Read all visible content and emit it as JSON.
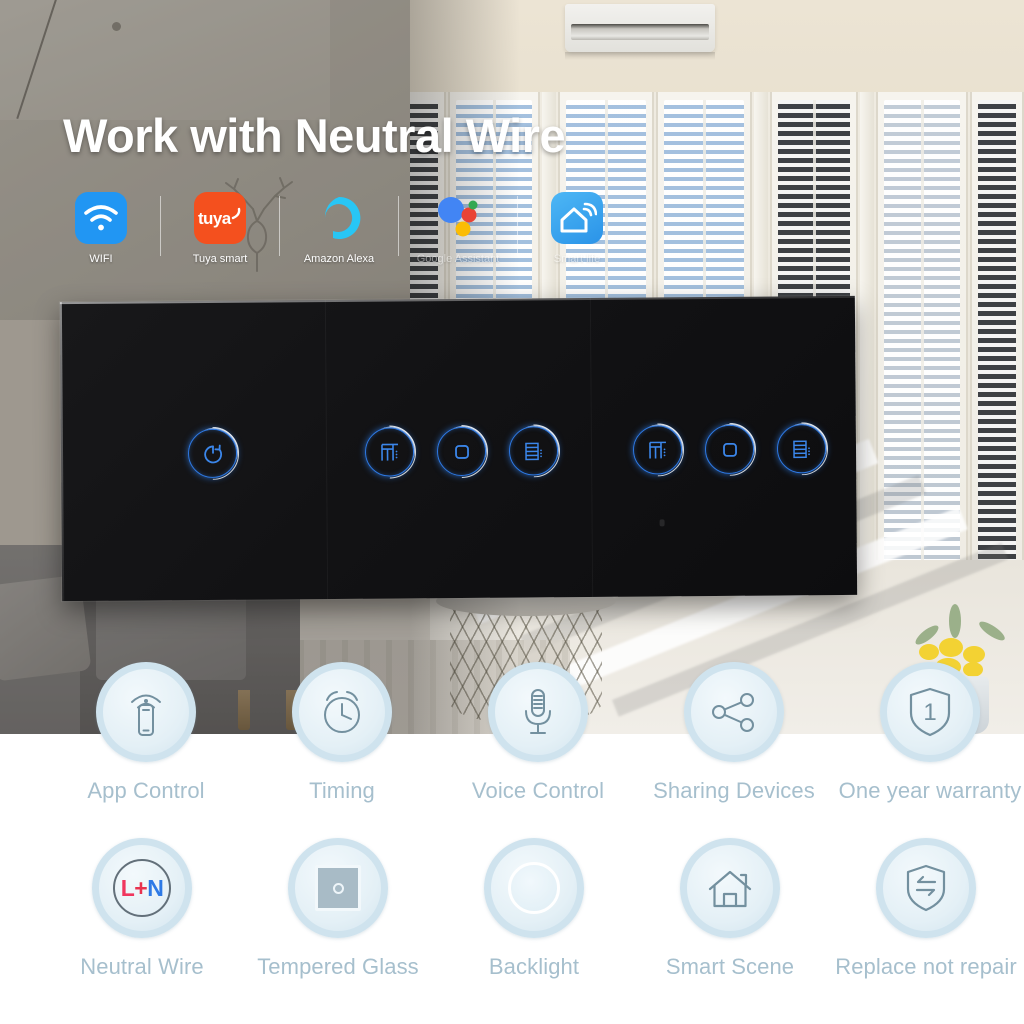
{
  "headline": "Work with Neutral Wire",
  "colors": {
    "wifi_blue": "#2196f3",
    "tuya_orange": "#f4501e",
    "alexa_cyan": "#28c6f5",
    "smartlife_blue": "#3aa8f0",
    "touch_key_blue": "#2e7ae6",
    "feature_label": "#a6bfcd",
    "feature_circle_border": "#cfe3ee",
    "panel_black": "#121214",
    "neutral_l_red": "#f0365e",
    "neutral_n_blue": "#2e7ae6"
  },
  "badges": [
    {
      "icon": "wifi-icon",
      "label": "WIFI",
      "faint": false
    },
    {
      "icon": "tuya-logo-icon",
      "label": "Tuya smart",
      "faint": false
    },
    {
      "icon": "amazon-alexa-icon",
      "label": "Amazon Alexa",
      "faint": false
    },
    {
      "icon": "google-assistant-icon",
      "label": "Google Assistant",
      "faint": true
    },
    {
      "icon": "smart-life-icon",
      "label": "Smart life",
      "faint": true
    }
  ],
  "switch_panel": {
    "gangs": [
      {
        "name": "power-gang",
        "keys": [
          {
            "icon": "power-refresh-icon",
            "label": "Power"
          }
        ]
      },
      {
        "name": "curtain-gang-1",
        "keys": [
          {
            "icon": "curtain-open-icon",
            "label": "Open"
          },
          {
            "icon": "curtain-stop-icon",
            "label": "Stop"
          },
          {
            "icon": "curtain-close-icon",
            "label": "Close"
          }
        ]
      },
      {
        "name": "curtain-gang-2",
        "keys": [
          {
            "icon": "curtain-open-icon",
            "label": "Open"
          },
          {
            "icon": "curtain-stop-icon",
            "label": "Stop"
          },
          {
            "icon": "curtain-close-icon",
            "label": "Close"
          }
        ]
      }
    ]
  },
  "features_row_1": [
    {
      "icon": "app-control-icon",
      "label": "App Control"
    },
    {
      "icon": "alarm-clock-icon",
      "label": "Timing"
    },
    {
      "icon": "microphone-icon",
      "label": "Voice Control"
    },
    {
      "icon": "share-nodes-icon",
      "label": "Sharing Devices"
    },
    {
      "icon": "shield-one-icon",
      "label": "One year warranty"
    }
  ],
  "features_row_2": [
    {
      "icon": "neutral-wire-icon",
      "label": "Neutral Wire",
      "text": "L+N"
    },
    {
      "icon": "tempered-glass-icon",
      "label": "Tempered Glass"
    },
    {
      "icon": "backlight-icon",
      "label": "Backlight"
    },
    {
      "icon": "home-icon",
      "label": "Smart Scene"
    },
    {
      "icon": "shield-swap-icon",
      "label": "Replace not repair"
    }
  ]
}
